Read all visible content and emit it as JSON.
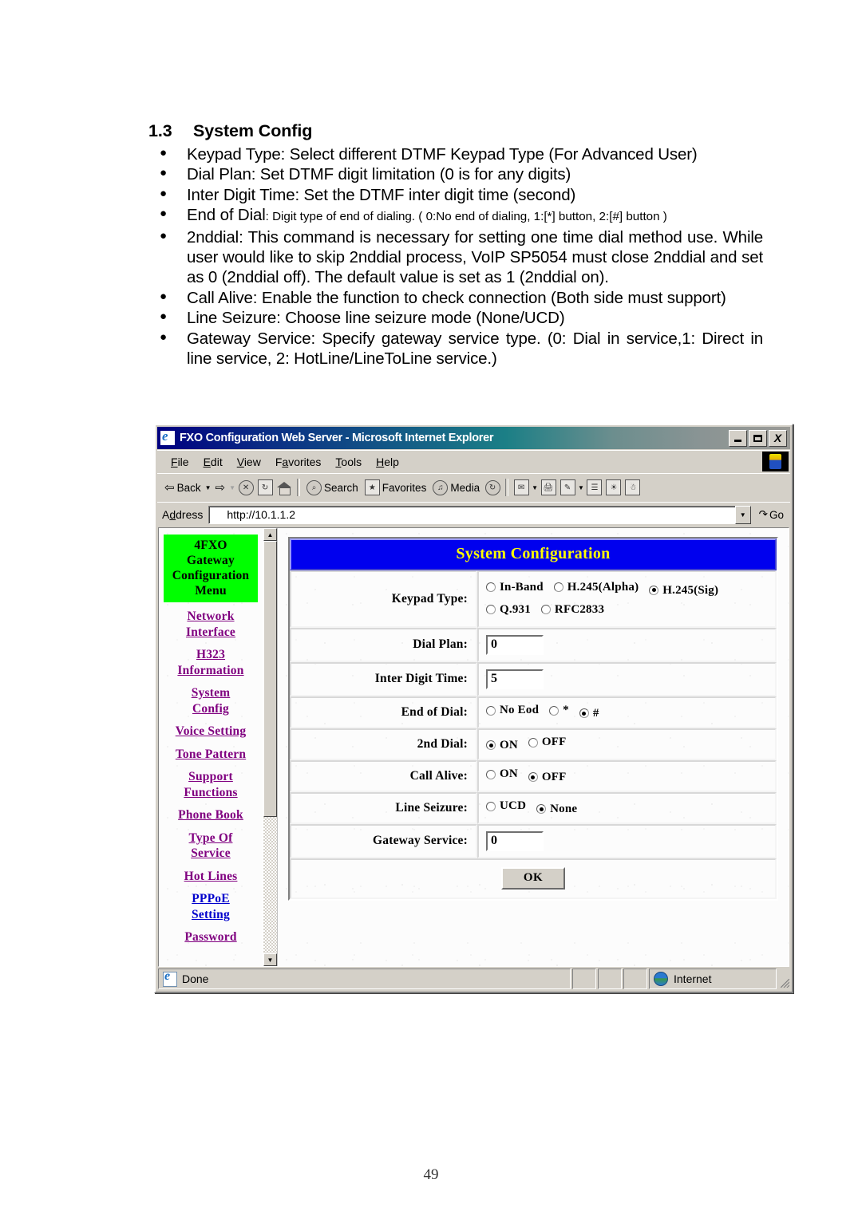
{
  "document": {
    "section_number": "1.3",
    "section_title": "System Config",
    "bullets": [
      {
        "text": "Keypad Type: Select different DTMF Keypad Type (For Advanced User)"
      },
      {
        "text": "Dial Plan: Set DTMF digit limitation (0 is for any digits)"
      },
      {
        "text": "Inter Digit Time: Set the DTMF inter digit time (second)"
      },
      {
        "lead": "End of Dial",
        "small": ": Digit type of end of dialing. ( 0:No end of dialing, 1:[*] button, 2:[#] button )"
      },
      {
        "text": "2nddial: This command is necessary for setting one time dial method use. While user would like to skip 2nddial process, VoIP SP5054 must close 2nddial and set as 0 (2nddial off). The default value is set as 1 (2nddial on)."
      },
      {
        "text": "Call Alive: Enable the function to check connection (Both side must support)"
      },
      {
        "text": "Line Seizure: Choose line seizure mode (None/UCD)"
      },
      {
        "text": "Gateway Service: Specify gateway service type. (0: Dial in service,1: Direct in line service, 2: HotLine/LineToLine service.)"
      }
    ],
    "page_number": "49"
  },
  "browser": {
    "title": "FXO Configuration Web Server - Microsoft Internet Explorer",
    "window_buttons": {
      "minimize": "minimize-button",
      "maximize": "maximize-button",
      "close": "X"
    },
    "menu": [
      "File",
      "Edit",
      "View",
      "Favorites",
      "Tools",
      "Help"
    ],
    "menu_mnemonics": [
      "F",
      "E",
      "V",
      "a",
      "T",
      "H"
    ],
    "toolbar": {
      "back": "Back",
      "forward": "",
      "stop": "stop-icon",
      "refresh": "refresh-icon",
      "home": "home-icon",
      "search": "Search",
      "favorites": "Favorites",
      "media": "Media",
      "history": "history-icon",
      "mail": "mail-icon",
      "print": "print-icon",
      "edit": "edit-icon",
      "discuss": "discuss-icon",
      "messenger": "messenger-icon",
      "realone": "realone-icon"
    },
    "address": {
      "label": "Address",
      "value": "http://10.1.1.2",
      "go": "Go"
    },
    "status": {
      "text": "Done",
      "zone": "Internet"
    }
  },
  "page": {
    "sidebar": {
      "menu_box": "4FXO Gateway Configuration Menu",
      "menu_box_lines": [
        "4FXO",
        "Gateway",
        "Configuration",
        "Menu"
      ],
      "links": [
        {
          "label": "Network Interface",
          "lines": [
            "Network",
            "Interface"
          ],
          "visited": true
        },
        {
          "label": "H323 Information",
          "lines": [
            "H323",
            "Information"
          ],
          "visited": true
        },
        {
          "label": "System Config",
          "lines": [
            "System",
            "Config"
          ],
          "visited": true
        },
        {
          "label": "Voice Setting",
          "lines": [
            "Voice Setting"
          ],
          "visited": true
        },
        {
          "label": "Tone Pattern",
          "lines": [
            "Tone Pattern"
          ],
          "visited": true
        },
        {
          "label": "Support Functions",
          "lines": [
            "Support",
            "Functions"
          ],
          "visited": true
        },
        {
          "label": "Phone Book",
          "lines": [
            "Phone Book"
          ],
          "visited": true
        },
        {
          "label": "Type Of Service",
          "lines": [
            "Type Of",
            "Service"
          ],
          "visited": true
        },
        {
          "label": "Hot Lines",
          "lines": [
            "Hot Lines"
          ],
          "visited": true
        },
        {
          "label": "PPPoE Setting",
          "lines": [
            "PPPoE",
            "Setting"
          ],
          "visited": false
        },
        {
          "label": "Password",
          "lines": [
            "Password"
          ],
          "visited": true
        }
      ]
    },
    "form": {
      "header": "System Configuration",
      "rows": {
        "keypad": {
          "label": "Keypad Type:",
          "options": [
            {
              "label": "In-Band",
              "selected": false
            },
            {
              "label": "H.245(Alpha)",
              "selected": false
            },
            {
              "label": "H.245(Sig)",
              "selected": true
            },
            {
              "label": "Q.931",
              "selected": false
            },
            {
              "label": "RFC2833",
              "selected": false
            }
          ]
        },
        "dial_plan": {
          "label": "Dial Plan:",
          "value": "0"
        },
        "inter_digit_time": {
          "label": "Inter Digit Time:",
          "value": "5"
        },
        "end_of_dial": {
          "label": "End of Dial:",
          "options": [
            {
              "label": "No Eod",
              "selected": false
            },
            {
              "label": "*",
              "selected": false
            },
            {
              "label": "#",
              "selected": true
            }
          ]
        },
        "second_dial": {
          "label": "2nd Dial:",
          "options": [
            {
              "label": "ON",
              "selected": true
            },
            {
              "label": "OFF",
              "selected": false
            }
          ]
        },
        "call_alive": {
          "label": "Call Alive:",
          "options": [
            {
              "label": "ON",
              "selected": false
            },
            {
              "label": "OFF",
              "selected": true
            }
          ]
        },
        "line_seizure": {
          "label": "Line Seizure:",
          "options": [
            {
              "label": "UCD",
              "selected": false
            },
            {
              "label": "None",
              "selected": true
            }
          ]
        },
        "gateway_service": {
          "label": "Gateway Service:",
          "value": "0"
        }
      },
      "submit": "OK"
    }
  },
  "colors": {
    "header_bg": "#0000ee",
    "header_text": "#ffff00",
    "menu_box_bg": "#00ff00",
    "link_visited": "#800080",
    "link_unvisited": "#0000cc",
    "titlebar_start": "#000080",
    "titlebar_end": "#9a9a96",
    "chrome": "#d4d0c8"
  }
}
